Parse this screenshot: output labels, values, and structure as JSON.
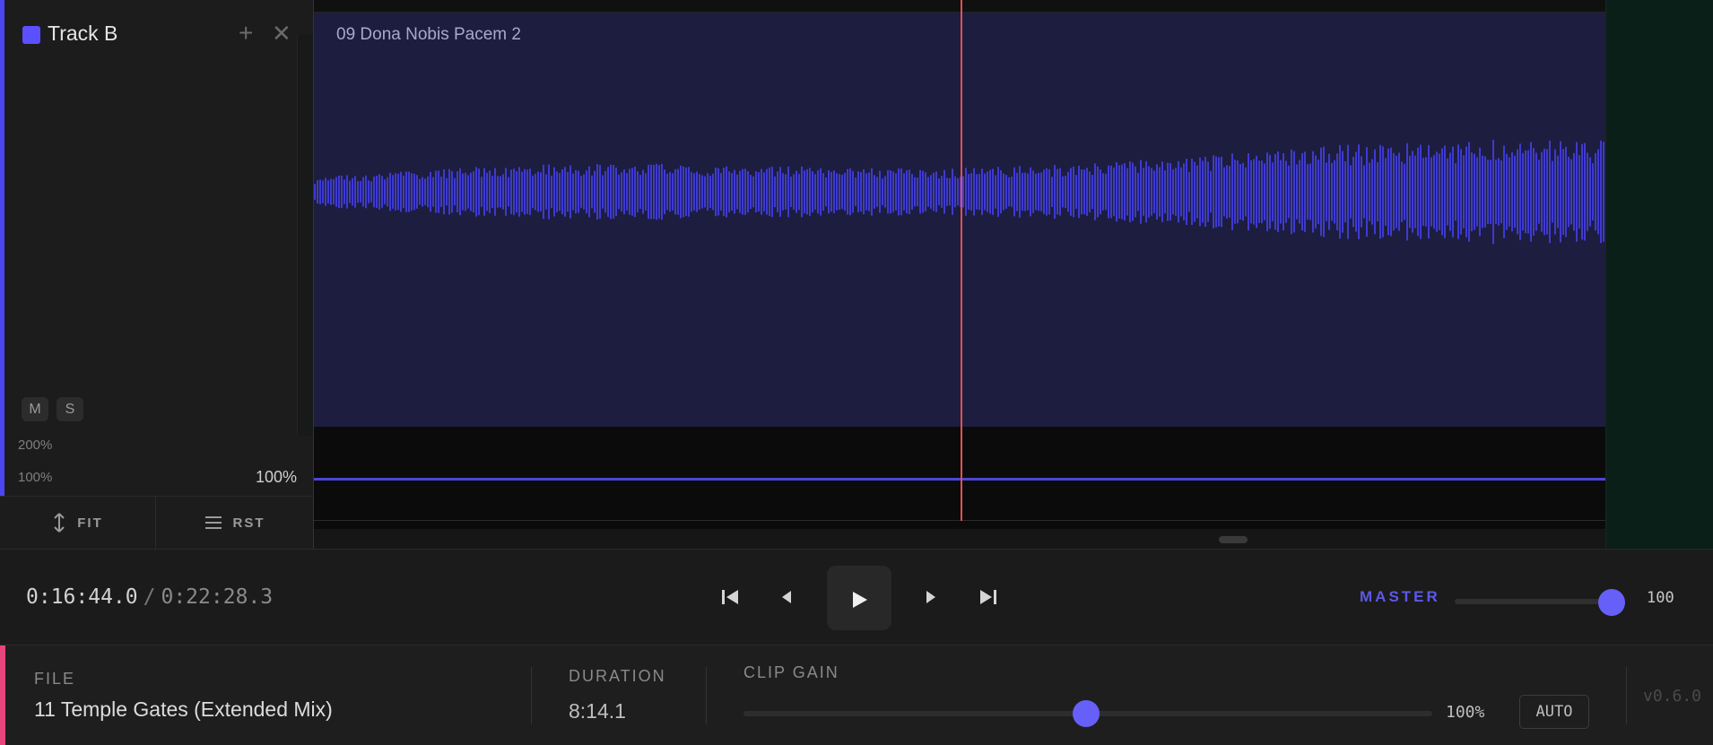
{
  "track": {
    "name": "Track B",
    "color": "#5a50ff",
    "add_icon": "plus-icon",
    "close_icon": "close-icon",
    "mute_label": "M",
    "solo_label": "S",
    "scale_top": "200%",
    "scale_bottom": "100%",
    "volume": "100%",
    "fit_label": "FIT",
    "reset_label": "RST"
  },
  "clip": {
    "title": "09 Dona Nobis Pacem 2",
    "color": "#1d1d40",
    "waveform_color": "#3e3ad0"
  },
  "transport": {
    "current_time": "0:16:44.0",
    "separator": "/",
    "total_time": "0:22:28.3",
    "buttons": [
      "skip-to-start-icon",
      "step-back-icon",
      "play-icon",
      "step-forward-icon",
      "skip-to-end-icon"
    ],
    "master_label": "MASTER",
    "master_value": "100",
    "master_level": 1.0
  },
  "info": {
    "file_label": "FILE",
    "file_name": "11 Temple Gates (Extended Mix)",
    "duration_label": "DURATION",
    "duration_value": "8:14.1",
    "gain_label": "CLIP GAIN",
    "gain_value": "100%",
    "gain_level": 0.5,
    "auto_label": "AUTO",
    "version": "v0.6.0"
  },
  "colors": {
    "accent": "#5a50ff",
    "playhead": "#e3504f",
    "info_accent": "#e8457e"
  }
}
